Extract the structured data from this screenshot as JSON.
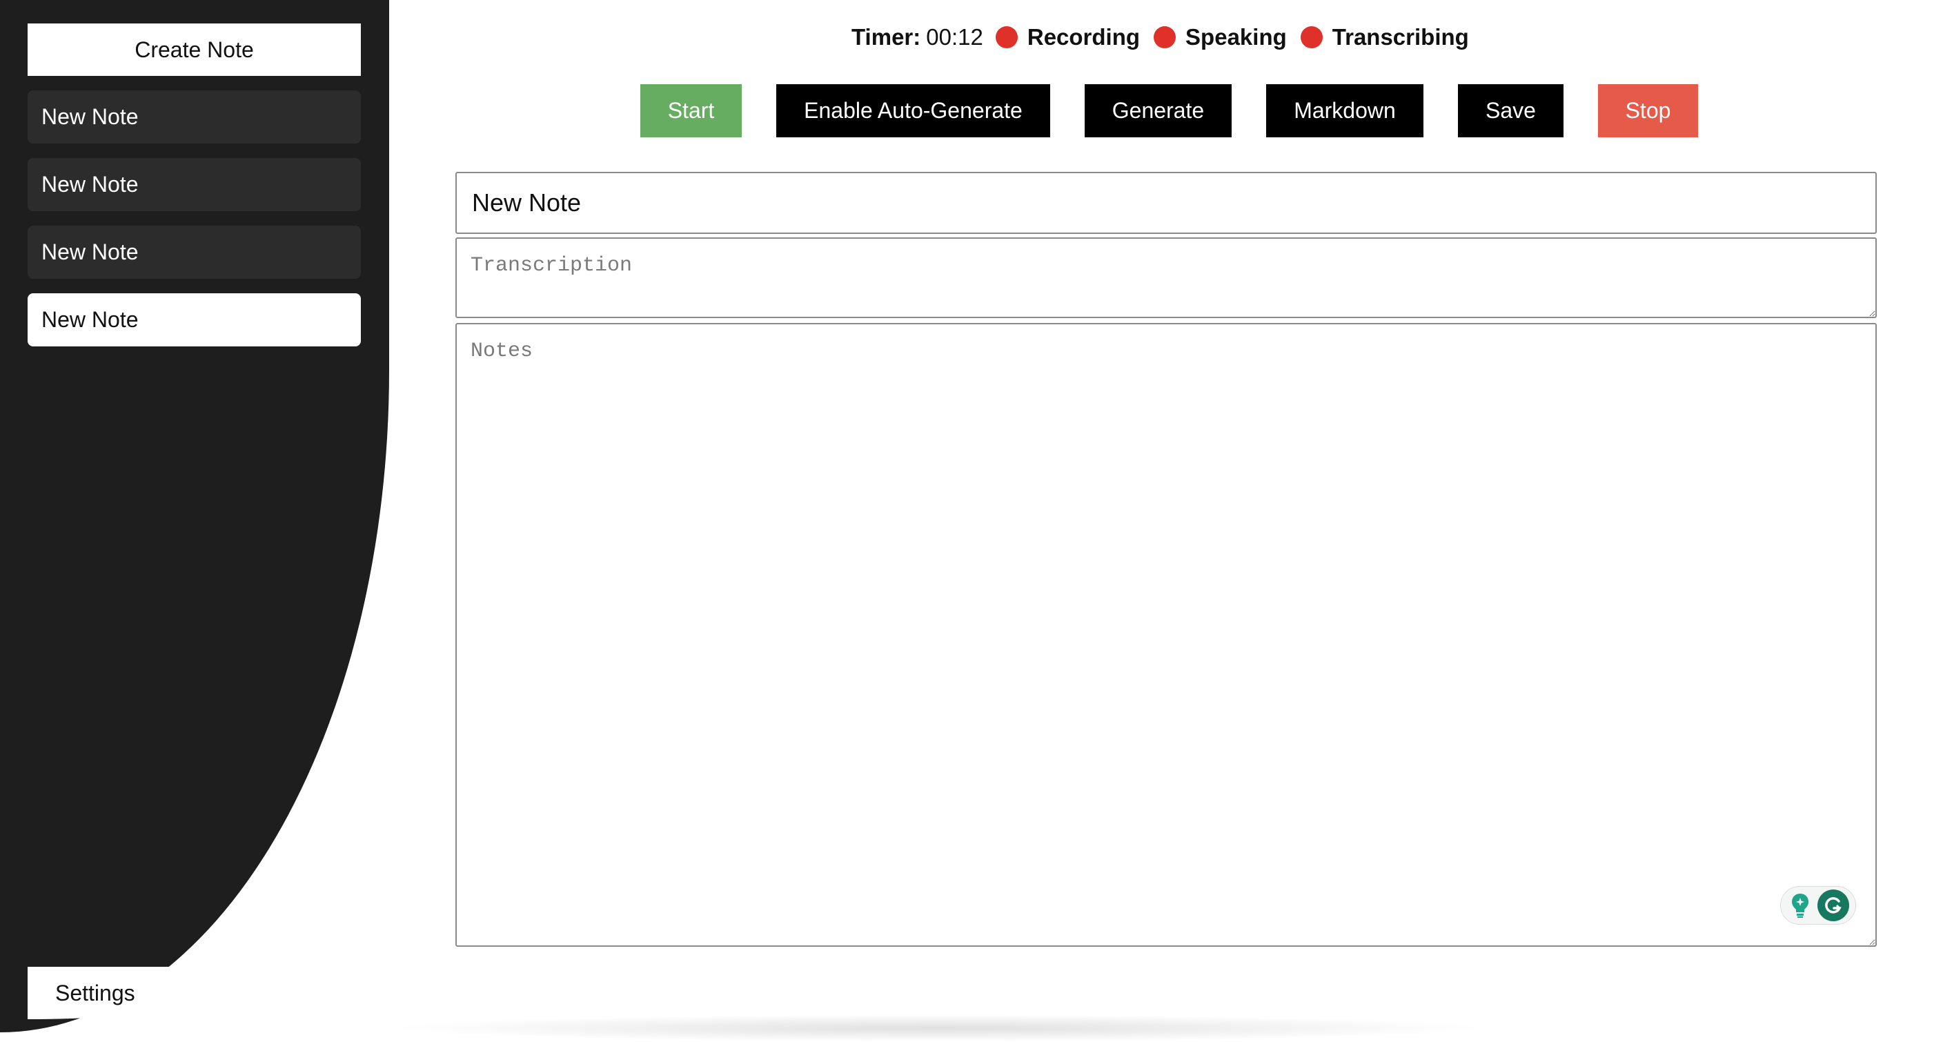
{
  "sidebar": {
    "create_label": "Create Note",
    "notes": [
      {
        "label": "New Note",
        "active": false
      },
      {
        "label": "New Note",
        "active": false
      },
      {
        "label": "New Note",
        "active": false
      },
      {
        "label": "New Note",
        "active": true
      }
    ],
    "settings_label": "Settings"
  },
  "status": {
    "timer_label": "Timer:",
    "timer_value": "00:12",
    "indicators": [
      {
        "label": "Recording",
        "color": "#e0302a"
      },
      {
        "label": "Speaking",
        "color": "#e0302a"
      },
      {
        "label": "Transcribing",
        "color": "#e0302a"
      }
    ]
  },
  "toolbar": {
    "start_label": "Start",
    "autogen_label": "Enable Auto-Generate",
    "generate_label": "Generate",
    "markdown_label": "Markdown",
    "save_label": "Save",
    "stop_label": "Stop",
    "start_color": "#66ad62",
    "stop_color": "#e55a49"
  },
  "editor": {
    "title_value": "New Note",
    "transcription_placeholder": "Transcription",
    "notes_placeholder": "Notes"
  },
  "widget": {
    "icons": [
      "lightbulb-icon",
      "grammarly-icon"
    ]
  }
}
